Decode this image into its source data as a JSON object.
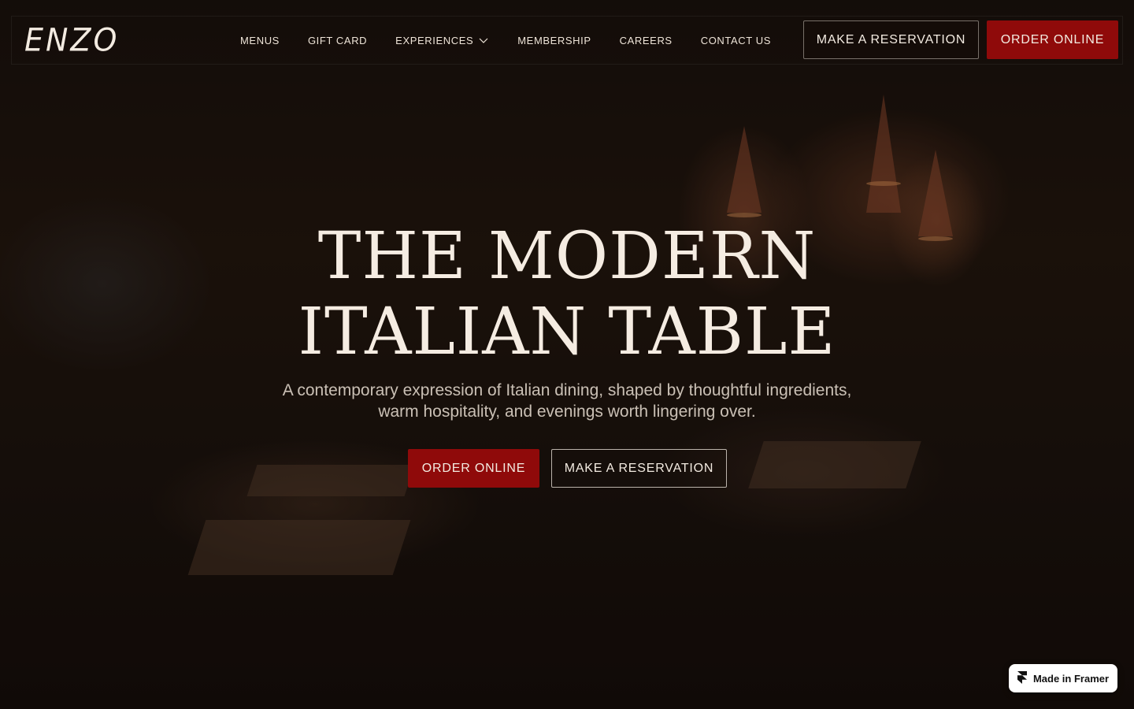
{
  "brand": {
    "logo_text": "ENZO"
  },
  "nav": {
    "items": [
      {
        "label": "MENUS"
      },
      {
        "label": "GIFT CARD"
      },
      {
        "label": "EXPERIENCES",
        "has_dropdown": true
      },
      {
        "label": "MEMBERSHIP"
      },
      {
        "label": "CAREERS"
      },
      {
        "label": "CONTACT US"
      }
    ]
  },
  "header_actions": {
    "reserve_label": "MAKE A RESERVATION",
    "order_label": "ORDER ONLINE"
  },
  "hero": {
    "title_line1": "THE MODERN",
    "title_line2": "ITALIAN TABLE",
    "subtitle_line1": "A contemporary expression of Italian dining, shaped by thoughtful ingredients,",
    "subtitle_line2": "warm hospitality, and evenings worth lingering over.",
    "order_label": "ORDER ONLINE",
    "reserve_label": "MAKE A RESERVATION"
  },
  "badge": {
    "label": "Made in Framer",
    "icon": "framer-logo-icon"
  },
  "colors": {
    "accent_red": "#8f0a0a",
    "text_cream": "#f3ebe1",
    "background": "#140c09"
  }
}
